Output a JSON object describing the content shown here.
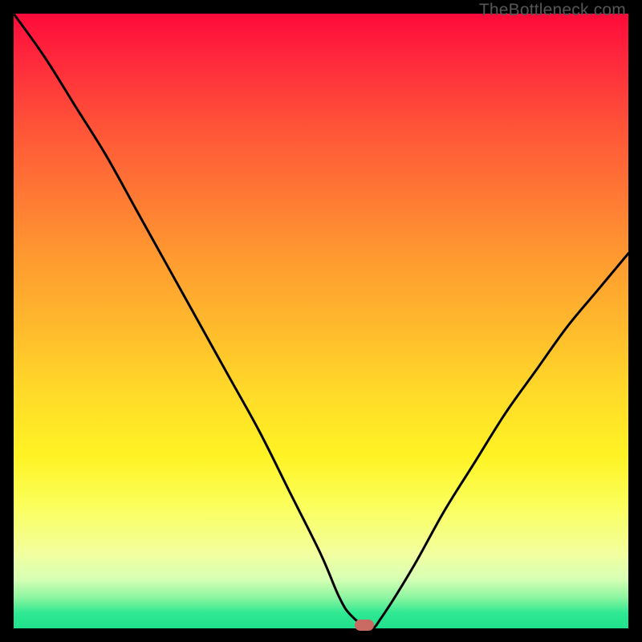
{
  "watermark": "TheBottleneck.com",
  "colors": {
    "background": "#000000",
    "gradient_top": "#ff0a3a",
    "gradient_bottom": "#20e08c",
    "curve": "#000000",
    "marker": "#c96a63"
  },
  "chart_data": {
    "type": "line",
    "title": "",
    "xlabel": "",
    "ylabel": "",
    "xlim": [
      0,
      100
    ],
    "ylim": [
      0,
      100
    ],
    "series": [
      {
        "name": "bottleneck-curve",
        "x": [
          0,
          5,
          10,
          15,
          20,
          25,
          30,
          35,
          40,
          45,
          50,
          53,
          55,
          58,
          60,
          65,
          70,
          75,
          80,
          85,
          90,
          95,
          100
        ],
        "values": [
          100,
          93,
          85,
          77,
          68,
          59,
          50,
          41,
          32,
          22,
          12,
          5,
          2,
          0,
          2,
          10,
          19,
          27,
          35,
          42,
          49,
          55,
          61
        ]
      }
    ],
    "annotations": [
      {
        "name": "min-marker",
        "x": 57,
        "y": 0
      }
    ]
  }
}
